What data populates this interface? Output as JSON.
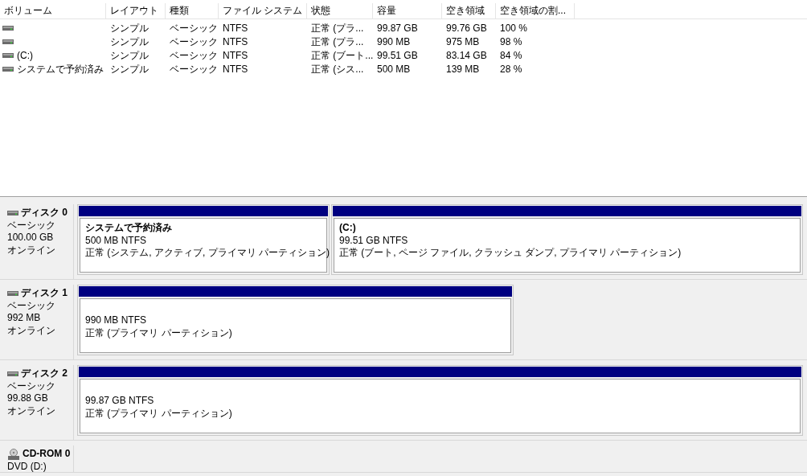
{
  "volume_list": {
    "columns": [
      "ボリューム",
      "レイアウト",
      "種類",
      "ファイル システム",
      "状態",
      "容量",
      "空き領域",
      "空き領域の割..."
    ],
    "rows": [
      {
        "cells": [
          "",
          "シンプル",
          "ベーシック",
          "NTFS",
          "正常 (プラ...",
          "99.87 GB",
          "99.76 GB",
          "100 %"
        ]
      },
      {
        "cells": [
          "",
          "シンプル",
          "ベーシック",
          "NTFS",
          "正常 (プラ...",
          "990 MB",
          "975 MB",
          "98 %"
        ]
      },
      {
        "cells": [
          "(C:)",
          "シンプル",
          "ベーシック",
          "NTFS",
          "正常 (ブート...",
          "99.51 GB",
          "83.14 GB",
          "84 %"
        ]
      },
      {
        "cells": [
          "システムで予約済み",
          "シンプル",
          "ベーシック",
          "NTFS",
          "正常 (シス...",
          "500 MB",
          "139 MB",
          "28 %"
        ]
      }
    ]
  },
  "disks": [
    {
      "kind": "disk",
      "name": "ディスク 0",
      "type": "ベーシック",
      "size": "100.00 GB",
      "status": "オンライン",
      "partitions": [
        {
          "label": "システムで予約済み",
          "size": "500 MB NTFS",
          "status": "正常 (システム, アクティブ, プライマリ パーティション)"
        },
        {
          "label": "(C:)",
          "size": "99.51 GB NTFS",
          "status": "正常 (ブート, ページ ファイル, クラッシュ ダンプ, プライマリ パーティション)"
        }
      ]
    },
    {
      "kind": "disk",
      "name": "ディスク 1",
      "type": "ベーシック",
      "size": "992 MB",
      "status": "オンライン",
      "partitions": [
        {
          "size": "990 MB NTFS",
          "status": "正常 (プライマリ パーティション)"
        }
      ]
    },
    {
      "kind": "disk",
      "name": "ディスク 2",
      "type": "ベーシック",
      "size": "99.88 GB",
      "status": "オンライン",
      "partitions": [
        {
          "size": "99.87 GB NTFS",
          "status": "正常 (プライマリ パーティション)"
        }
      ]
    },
    {
      "kind": "cdrom",
      "name": "CD-ROM 0",
      "type": "DVD (D:)"
    }
  ]
}
